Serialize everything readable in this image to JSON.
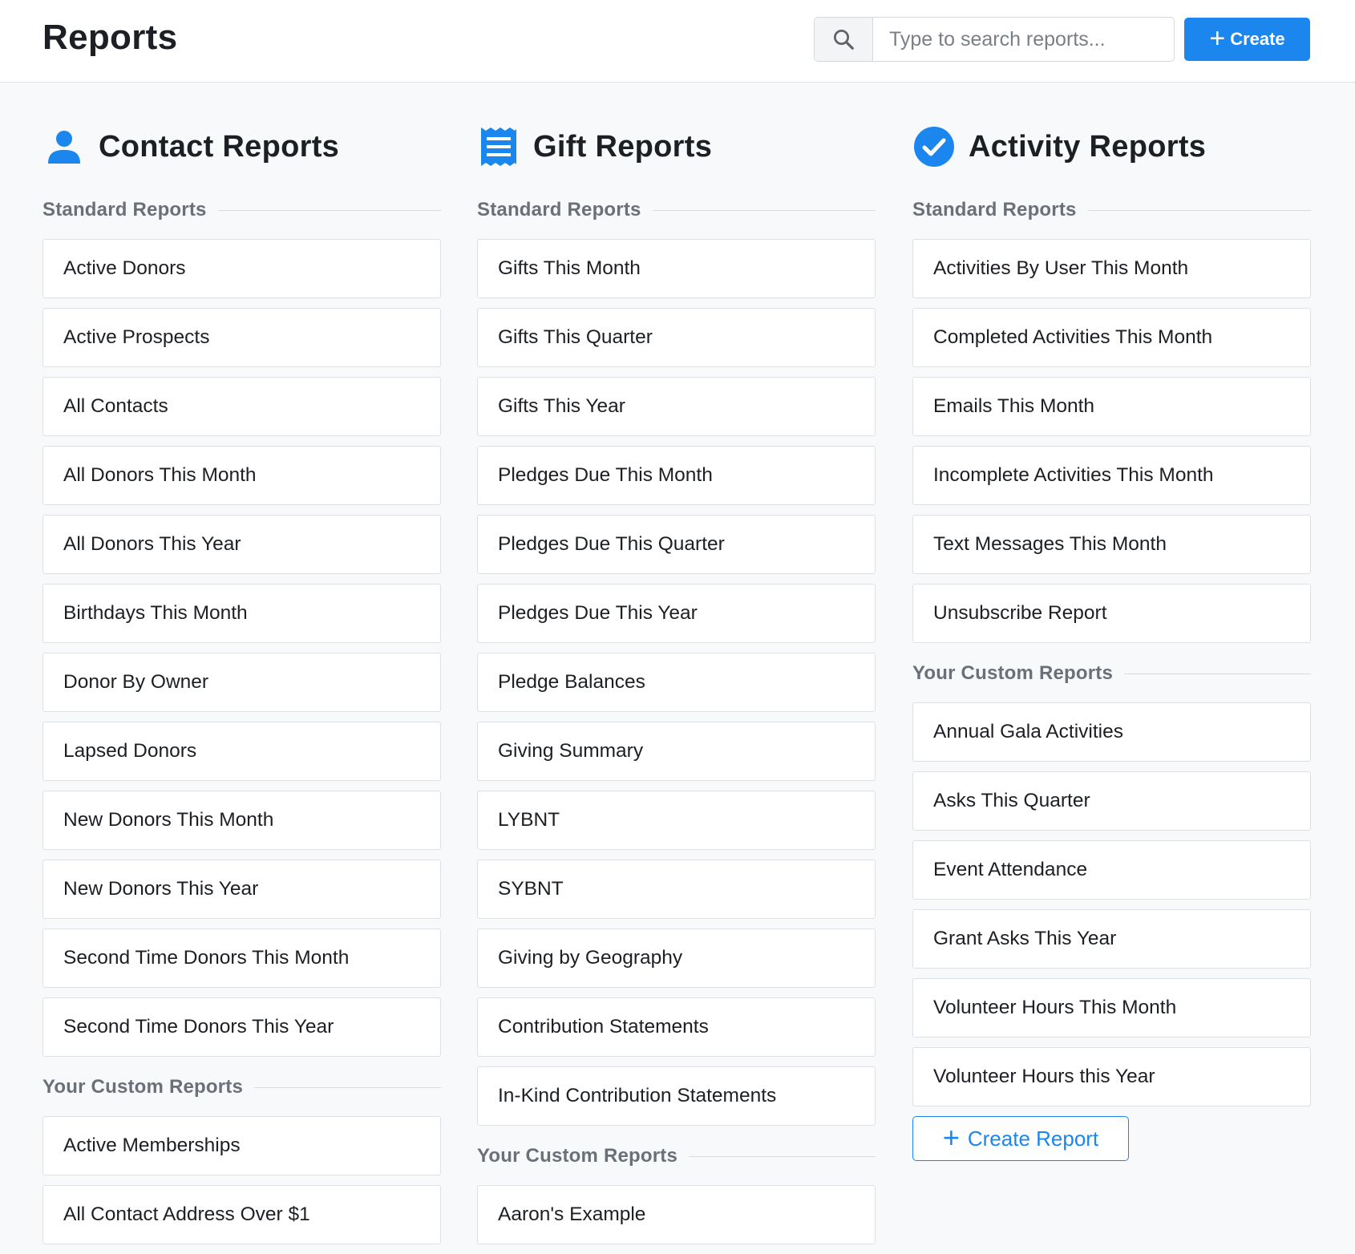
{
  "header": {
    "title": "Reports",
    "search_placeholder": "Type to search reports...",
    "create_label": "Create"
  },
  "colors": {
    "accent": "#1b86ee",
    "text": "#1c1f24",
    "muted": "#6b7078"
  },
  "columns": {
    "contact": {
      "title": "Contact Reports",
      "icon": "person-icon",
      "standard_label": "Standard Reports",
      "standard": [
        "Active Donors",
        "Active Prospects",
        "All Contacts",
        "All Donors This Month",
        "All Donors This Year",
        "Birthdays This Month",
        "Donor By Owner",
        "Lapsed Donors",
        "New Donors This Month",
        "New Donors This Year",
        "Second Time Donors This Month",
        "Second Time Donors This Year"
      ],
      "custom_label": "Your Custom Reports",
      "custom": [
        "Active Memberships",
        "All Contact Address Over $1"
      ]
    },
    "gift": {
      "title": "Gift Reports",
      "icon": "receipt-icon",
      "standard_label": "Standard Reports",
      "standard": [
        "Gifts This Month",
        "Gifts This Quarter",
        "Gifts This Year",
        "Pledges Due This Month",
        "Pledges Due This Quarter",
        "Pledges Due This Year",
        "Pledge Balances",
        "Giving Summary",
        "LYBNT",
        "SYBNT",
        "Giving by Geography",
        "Contribution Statements",
        "In-Kind Contribution Statements"
      ],
      "custom_label": "Your Custom Reports",
      "custom": [
        "Aaron's Example"
      ]
    },
    "activity": {
      "title": "Activity Reports",
      "icon": "check-circle-icon",
      "standard_label": "Standard Reports",
      "standard": [
        "Activities By User This Month",
        "Completed Activities This Month",
        "Emails This Month",
        "Incomplete Activities This Month",
        "Text Messages This Month",
        "Unsubscribe Report"
      ],
      "custom_label": "Your Custom Reports",
      "custom": [
        "Annual Gala Activities",
        "Asks This Quarter",
        "Event Attendance",
        "Grant Asks This Year",
        "Volunteer Hours This Month",
        "Volunteer Hours this Year"
      ],
      "create_report_label": "Create Report"
    }
  }
}
